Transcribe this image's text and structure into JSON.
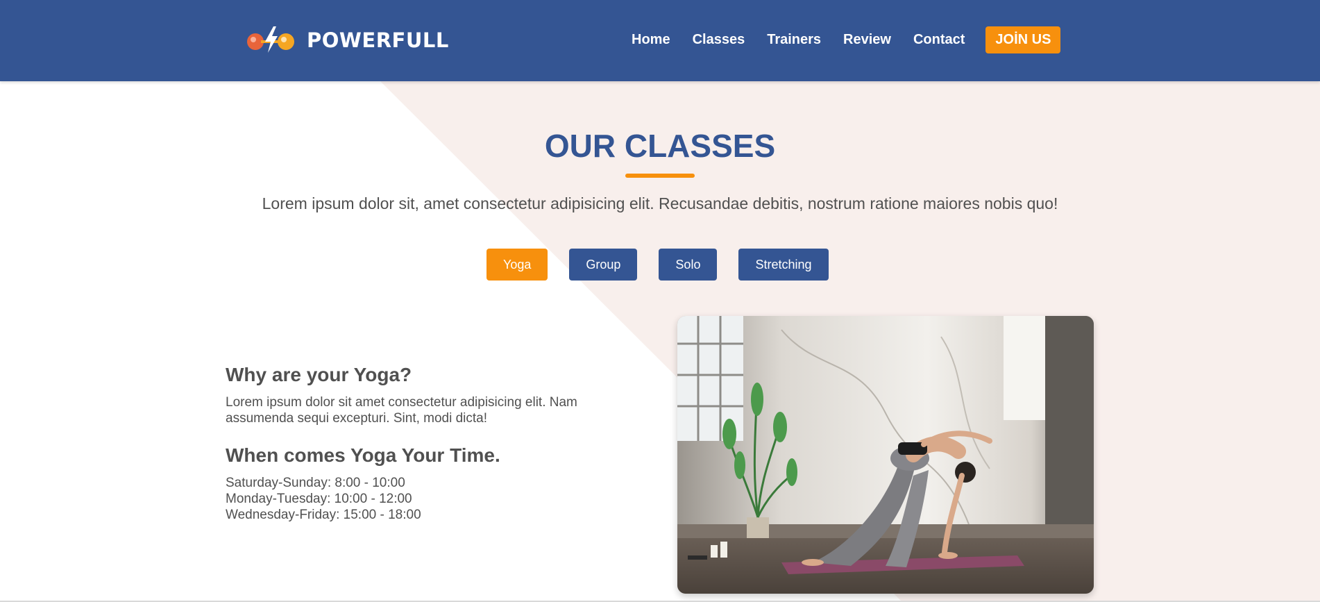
{
  "header": {
    "logo_text": "POWERFULL",
    "nav": [
      "Home",
      "Classes",
      "Trainers",
      "Review",
      "Contact"
    ],
    "join_label": "JOİN US"
  },
  "classes": {
    "title": "OUR CLASSES",
    "description": "Lorem ipsum dolor sit, amet consectetur adipisicing elit. Recusandae debitis, nostrum ratione maiores nobis quo!",
    "tabs": [
      "Yoga",
      "Group",
      "Solo",
      "Stretching"
    ],
    "active_tab": "Yoga"
  },
  "detail": {
    "why_heading": "Why are your Yoga?",
    "why_text": "Lorem ipsum dolor sit amet consectetur adipisicing elit. Nam assumenda sequi excepturi. Sint, modi dicta!",
    "when_heading": "When comes Yoga Your Time.",
    "schedule": [
      "Saturday-Sunday: 8:00 - 10:00",
      "Monday-Tuesday: 10:00 - 12:00",
      "Wednesday-Friday: 15:00 - 18:00"
    ]
  },
  "colors": {
    "brand_blue": "#345593",
    "accent_orange": "#f7900d",
    "bg_pink": "#f8efec"
  },
  "icons": [
    "dumbbell-logo-icon",
    "lightning-icon"
  ]
}
